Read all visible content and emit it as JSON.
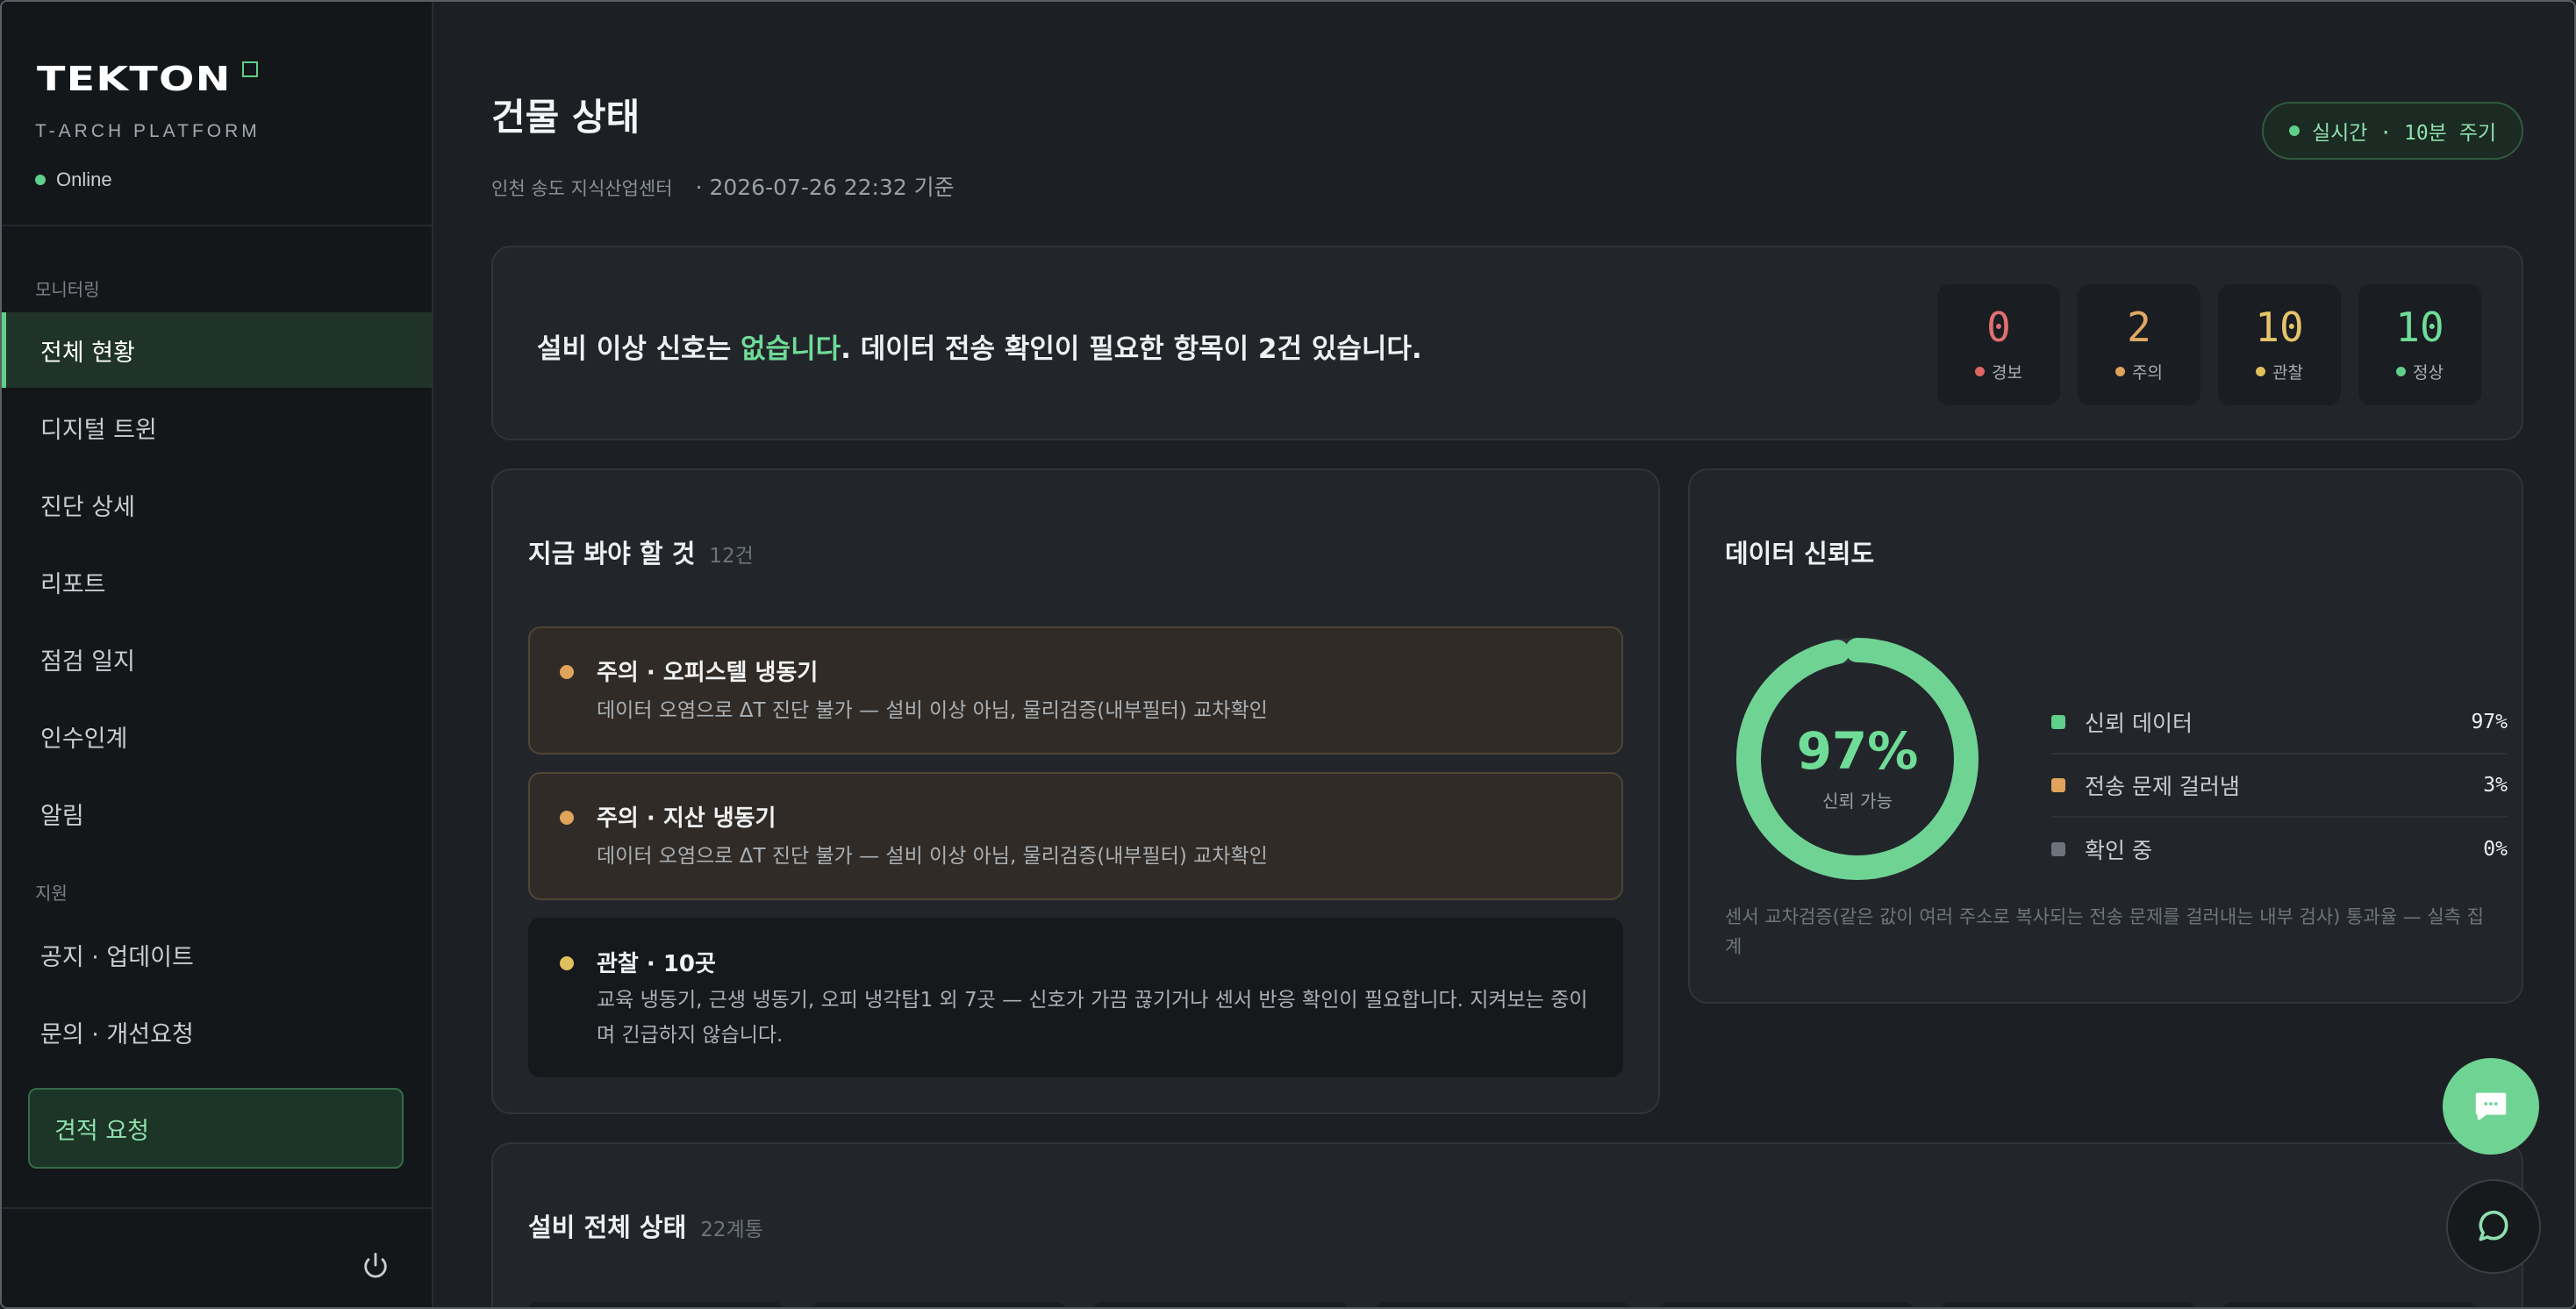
{
  "sidebar": {
    "logo": "TEKTON",
    "platform": "T-ARCH PLATFORM",
    "status": "Online",
    "sections": {
      "monitoring": "모니터링",
      "support": "지원"
    },
    "items": [
      {
        "label": "전체 현황",
        "active": true
      },
      {
        "label": "디지털 트윈"
      },
      {
        "label": "진단 상세"
      },
      {
        "label": "리포트"
      },
      {
        "label": "점검 일지"
      },
      {
        "label": "인수인계"
      },
      {
        "label": "알림"
      }
    ],
    "support_items": [
      {
        "label": "공지 · 업데이트"
      },
      {
        "label": "문의 · 개선요청"
      }
    ],
    "cta": "견적 요청",
    "power_icon": "power-icon"
  },
  "header": {
    "title": "건물 상태",
    "site": "인천 송도 지식산업센터",
    "timestamp": "· 2026-07-26 22:32 기준",
    "live_label": "실시간 · 10분 주기"
  },
  "summary": {
    "text_before": "설비 이상 신호는 ",
    "text_highlight": "없습니다",
    "text_after": ". 데이터 전송 확인이 필요한 항목이 2건 있습니다.",
    "stats": [
      {
        "value": "0",
        "label": "경보",
        "color": "#e06565",
        "num_color": "#e07070"
      },
      {
        "value": "2",
        "label": "주의",
        "color": "#e0a35c",
        "num_color": "#e0a864"
      },
      {
        "value": "10",
        "label": "관찰",
        "color": "#e0c05c",
        "num_color": "#e4c46a"
      },
      {
        "value": "10",
        "label": "정상",
        "color": "#5fcf8a",
        "num_color": "#6fdc97"
      }
    ]
  },
  "todo": {
    "title": "지금 봐야 할 것",
    "count": "12건",
    "items": [
      {
        "title": "주의 · 오피스텔 냉동기",
        "desc": "데이터 오염으로 ΔT 진단 불가 — 설비 이상 아님, 물리검증(내부필터) 교차확인",
        "kind": "warn",
        "dot": "#e0a35c"
      },
      {
        "title": "주의 · 지산 냉동기",
        "desc": "데이터 오염으로 ΔT 진단 불가 — 설비 이상 아님, 물리검증(내부필터) 교차확인",
        "kind": "warn",
        "dot": "#e0a35c"
      },
      {
        "title": "관찰 · 10곳",
        "desc": "교육 냉동기, 근생 냉동기, 오피 냉각탑1 외 7곳 — 신호가 가끔 끊기거나 센서 반응 확인이 필요합니다. 지켜보는 중이며 긴급하지 않습니다.",
        "kind": "obs",
        "dot": "#e0c05c"
      }
    ]
  },
  "reliability": {
    "title": "데이터 신뢰도",
    "percent": "97%",
    "percent_value": 97,
    "sub": "신뢰 가능",
    "legend": [
      {
        "name": "신뢰 데이터",
        "value": "97%",
        "color": "#5fcf8a"
      },
      {
        "name": "전송 문제 걸러냄",
        "value": "3%",
        "color": "#e0a35c"
      },
      {
        "name": "확인 중",
        "value": "0%",
        "color": "#6d737a"
      }
    ],
    "note": "센서 교차검증(같은 값이 여러 주소로 복사되는 전송 문제를 걸러내는 내부 검사) 통과율 — 실측 집계"
  },
  "equipment": {
    "title": "설비 전체 상태",
    "count": "22계통"
  },
  "fab": {
    "chat_icon": "chat-bubble-icon",
    "message_icon": "message-icon"
  }
}
